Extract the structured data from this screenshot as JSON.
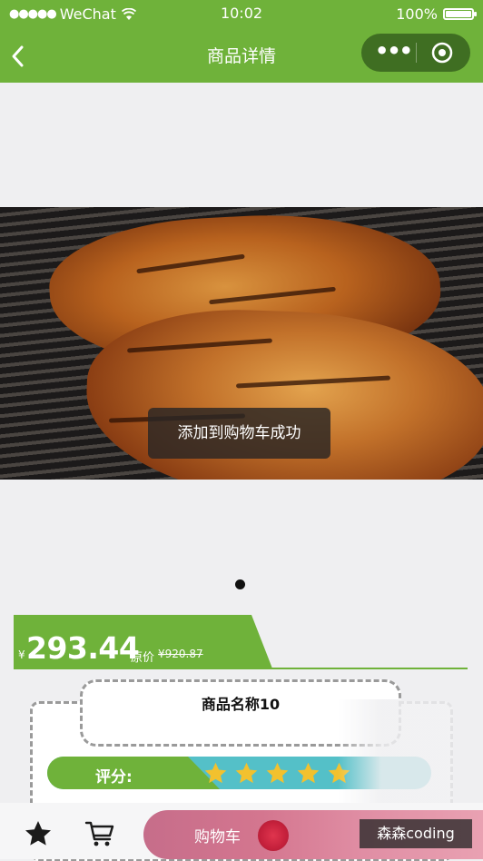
{
  "status": {
    "carrier": "WeChat",
    "time": "10:02",
    "battery": "100%"
  },
  "nav": {
    "title": "商品详情",
    "back_icon": "chevron-left-icon",
    "more_icon": "more-dots-icon",
    "close_icon": "target-circle-icon"
  },
  "product": {
    "image": "grilled-meat-photo",
    "price_symbol": "¥",
    "price": "293.44",
    "original_label": "原价",
    "original_price": "¥920.87",
    "name": "商品名称10",
    "rating_label": "评分:",
    "rating_stars": 5
  },
  "toast": "添加到购物车成功",
  "carousel": {
    "current": 1
  },
  "bottom_bar": {
    "favorite_icon": "star-icon",
    "cart_icon": "cart-icon",
    "cart_button_label": "购物车"
  },
  "watermark": "森森coding",
  "colors": {
    "brand_green": "#6fb23a",
    "rating_teal": "#54c0c8",
    "cart_pink": "#d4768f",
    "star_gold": "#f2c12e"
  }
}
